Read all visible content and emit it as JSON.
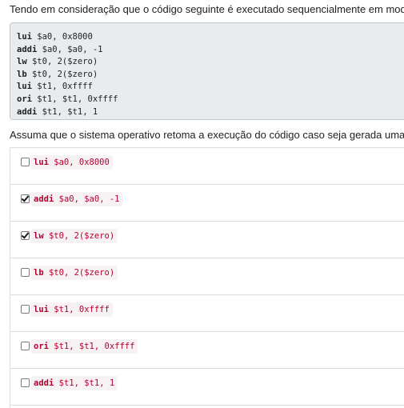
{
  "question": {
    "intro": "Tendo em consideração que o código seguinte é executado sequencialmente em modo não privi",
    "code_lines": [
      {
        "op": "lui",
        "args": " $a0, 0x8000"
      },
      {
        "op": "addi",
        "args": " $a0, $a0, -1"
      },
      {
        "op": "lw",
        "args": " $t0, 2($zero)"
      },
      {
        "op": "lb",
        "args": " $t0, 2($zero)"
      },
      {
        "op": "lui",
        "args": " $t1, 0xffff"
      },
      {
        "op": "ori",
        "args": " $t1, $t1, 0xffff"
      },
      {
        "op": "addi",
        "args": " $t1, $t1, 1"
      }
    ],
    "note": "Assuma que o sistema operativo retoma a execução do código caso seja gerada uma excepção."
  },
  "options": [
    {
      "op": "lui",
      "args": " $a0, 0x8000",
      "checked": false
    },
    {
      "op": "addi",
      "args": " $a0, $a0, -1",
      "checked": true
    },
    {
      "op": "lw",
      "args": " $t0, 2($zero)",
      "checked": true
    },
    {
      "op": "lb",
      "args": " $t0, 2($zero)",
      "checked": false
    },
    {
      "op": "lui",
      "args": " $t1, 0xffff",
      "checked": false
    },
    {
      "op": "ori",
      "args": " $t1, $t1, 0xffff",
      "checked": false
    },
    {
      "op": "addi",
      "args": " $t1, $t1, 1",
      "checked": false
    }
  ],
  "colors": {
    "code_background": "#e9ecef",
    "option_code_text": "#b8002e",
    "option_code_background": "#f7f2f4",
    "divider": "#dcdcdc"
  }
}
